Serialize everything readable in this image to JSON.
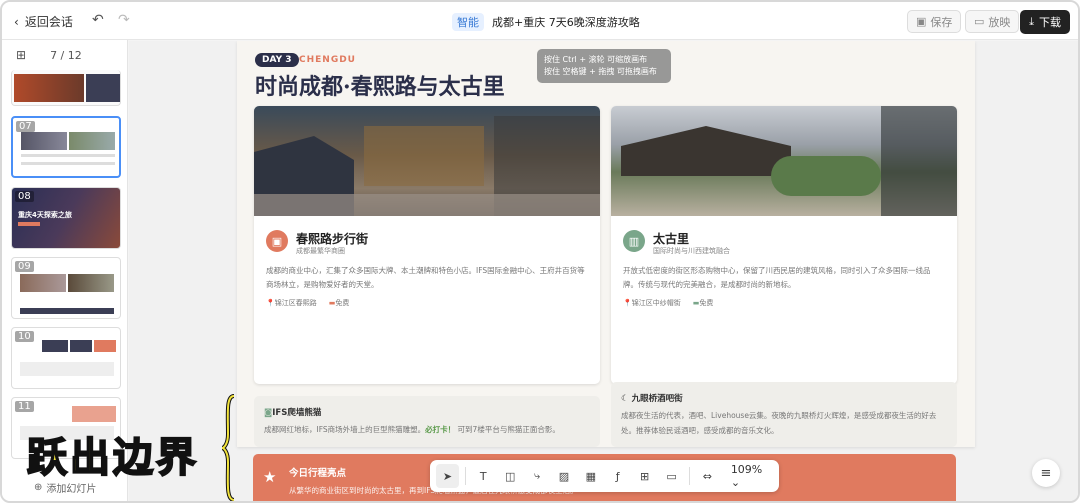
{
  "header": {
    "back_label": "返回会话",
    "ai_badge": "智能",
    "doc_title": "成都+重庆 7天6晚深度游攻略",
    "save_label": "保存",
    "present_label": "放映",
    "download_label": "下载"
  },
  "sidebar": {
    "page_indicator": "7 / 12",
    "add_slide_label": "添加幻灯片",
    "thumbs": [
      {
        "num": "",
        "title": ""
      },
      {
        "num": "07",
        "title": ""
      },
      {
        "num": "08",
        "title": "重庆4天探索之旅"
      },
      {
        "num": "09",
        "title": ""
      },
      {
        "num": "10",
        "title": ""
      },
      {
        "num": "11",
        "title": ""
      }
    ]
  },
  "slide": {
    "day": "DAY 3",
    "city": "CHENGDU",
    "title": "时尚成都·春熙路与太古里",
    "tip_line1": "按住 Ctrl + 滚轮 可缩放画布",
    "tip_line2": "按住 空格键 + 拖拽 可拖拽画布",
    "card1": {
      "title": "春熙路步行街",
      "subtitle": "成都最繁华商圈",
      "desc": "成都的商业中心，汇集了众多国际大牌、本土潮牌和特色小店。IFS国际金融中心、王府井百货等商场林立，是购物爱好者的天堂。",
      "location": "锦江区春熙路",
      "price": "免费"
    },
    "card2": {
      "title": "太古里",
      "subtitle": "国际时尚与川西建筑融合",
      "desc": "开放式低密度的街区形态购物中心，保留了川西民居的建筑风格，同时引入了众多国际一线品牌。传统与现代的完美融合，是成都时尚的新地标。",
      "location": "锦江区中纱帽街",
      "price": "免费"
    },
    "mini1": {
      "title": "IFS爬墙熊猫",
      "desc_pre": "成都网红地标，IFS商场外墙上的巨型熊猫雕塑。",
      "desc_em": "必打卡！",
      "desc_post": "可到7楼平台与熊猫正面合影。"
    },
    "mini2": {
      "title": "九眼桥酒吧街",
      "desc": "成都夜生活的代表，酒吧、Livehouse云集。夜晚的九眼桥灯火辉煌，是感受成都夜生活的好去处。推荐体验民谣酒吧，感受成都的音乐文化。"
    },
    "highlight": {
      "title": "今日行程亮点",
      "desc": "从繁华的商业街区到时尚的太古里，再到IFS爬墙熊猫，最后在九眼桥感受成都夜生活。"
    }
  },
  "toolbar": {
    "zoom": "109%"
  },
  "overlay": {
    "caption": "跃出边界"
  },
  "colors": {
    "accent": "#e07a5f",
    "navy": "#2b2f4a",
    "caption_yellow": "#f2e33d"
  }
}
